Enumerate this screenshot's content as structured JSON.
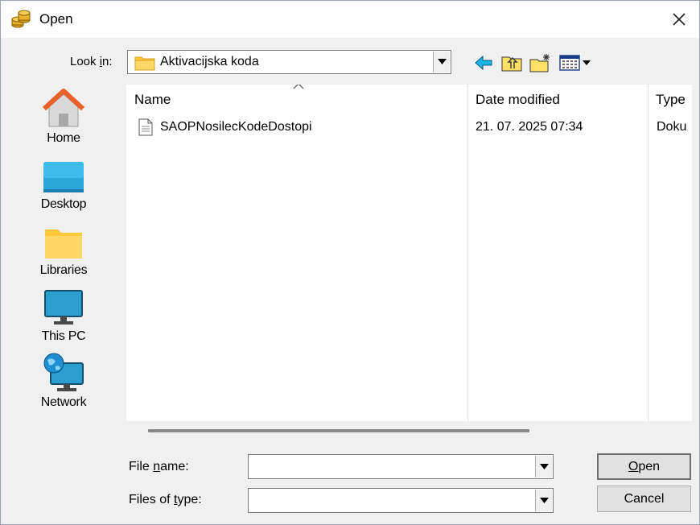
{
  "window": {
    "title": "Open",
    "icon": "coins-icon"
  },
  "lookin": {
    "label_pre": "Look ",
    "label_u": "i",
    "label_post": "n:",
    "value": "Aktivacijska koda",
    "icon": "folder-icon"
  },
  "toolbar": {
    "back_icon": "back-arrow-icon",
    "up_icon": "up-folder-icon",
    "new_folder_icon": "new-folder-icon",
    "view_icon": "view-menu-icon"
  },
  "places": [
    {
      "label": "Home",
      "icon": "home-icon"
    },
    {
      "label": "Desktop",
      "icon": "desktop-icon"
    },
    {
      "label": "Libraries",
      "icon": "libraries-folder-icon"
    },
    {
      "label": "This PC",
      "icon": "monitor-icon"
    },
    {
      "label": "Network",
      "icon": "network-icon"
    }
  ],
  "list": {
    "columns": [
      "Name",
      "Date modified",
      "Type"
    ],
    "rows": [
      {
        "name": "SAOPNosilecKodeDostopi",
        "date": "21. 07. 2025 07:34",
        "type": "Doku",
        "icon": "document-icon"
      }
    ]
  },
  "filename": {
    "label_pre": "File ",
    "label_u": "n",
    "label_post": "ame:",
    "value": ""
  },
  "filetype": {
    "label_pre": "Files of ",
    "label_u": "t",
    "label_post": "ype:",
    "value": ""
  },
  "buttons": {
    "open_u": "O",
    "open_rest": "pen",
    "cancel": "Cancel"
  },
  "colors": {
    "window_bg": "#f0f0f0",
    "list_bg": "#ffffff",
    "folder": "#ffc83d",
    "back_arrow": "#19b5e6"
  }
}
